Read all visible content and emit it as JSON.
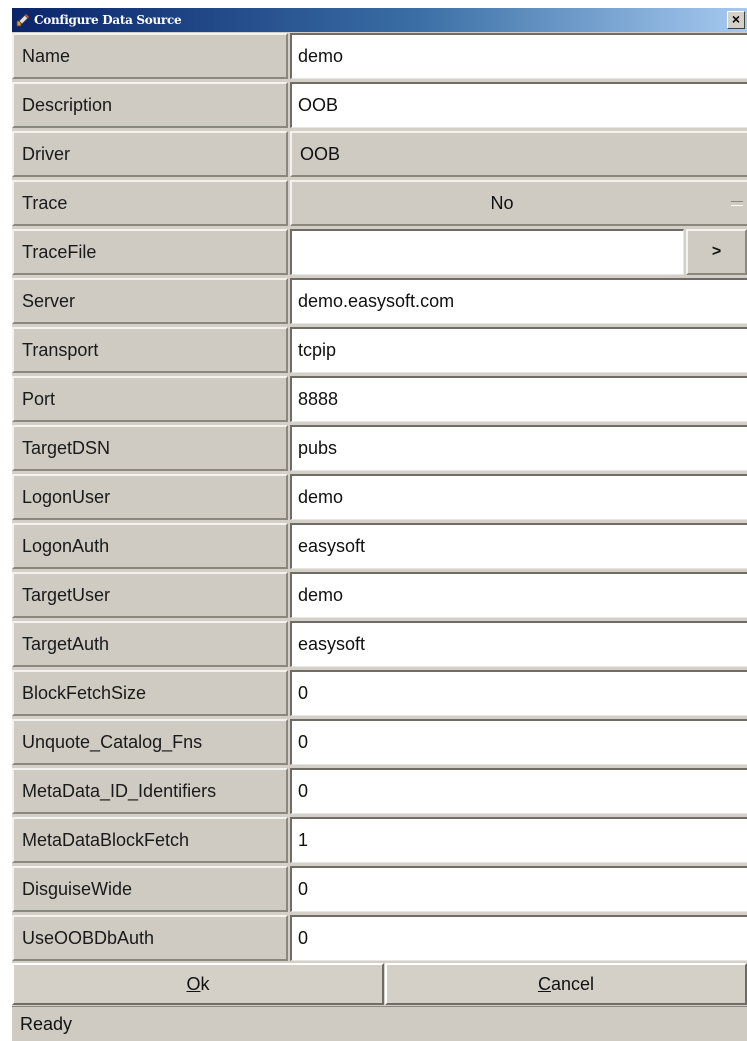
{
  "window": {
    "title": "Configure Data Source",
    "close_label": "×"
  },
  "fields": [
    {
      "label": "Name",
      "value": "demo"
    },
    {
      "label": "Description",
      "value": "OOB"
    },
    {
      "label": "Driver",
      "value": "OOB"
    },
    {
      "label": "Trace",
      "value": "No"
    },
    {
      "label": "TraceFile",
      "value": "",
      "browse_label": ">"
    },
    {
      "label": "Server",
      "value": "demo.easysoft.com"
    },
    {
      "label": "Transport",
      "value": "tcpip"
    },
    {
      "label": "Port",
      "value": "8888"
    },
    {
      "label": "TargetDSN",
      "value": "pubs"
    },
    {
      "label": "LogonUser",
      "value": "demo"
    },
    {
      "label": "LogonAuth",
      "value": "easysoft"
    },
    {
      "label": "TargetUser",
      "value": "demo"
    },
    {
      "label": "TargetAuth",
      "value": "easysoft"
    },
    {
      "label": "BlockFetchSize",
      "value": "0"
    },
    {
      "label": "Unquote_Catalog_Fns",
      "value": "0"
    },
    {
      "label": "MetaData_ID_Identifiers",
      "value": "0"
    },
    {
      "label": "MetaDataBlockFetch",
      "value": "1"
    },
    {
      "label": "DisguiseWide",
      "value": "0"
    },
    {
      "label": "UseOOBDbAuth",
      "value": "0"
    }
  ],
  "buttons": {
    "ok_mnemonic": "O",
    "ok_rest": "k",
    "cancel_mnemonic": "C",
    "cancel_rest": "ancel"
  },
  "status": {
    "text": "Ready"
  },
  "icons": {
    "title_icon": "app-tool-icon",
    "close": "close-icon"
  }
}
